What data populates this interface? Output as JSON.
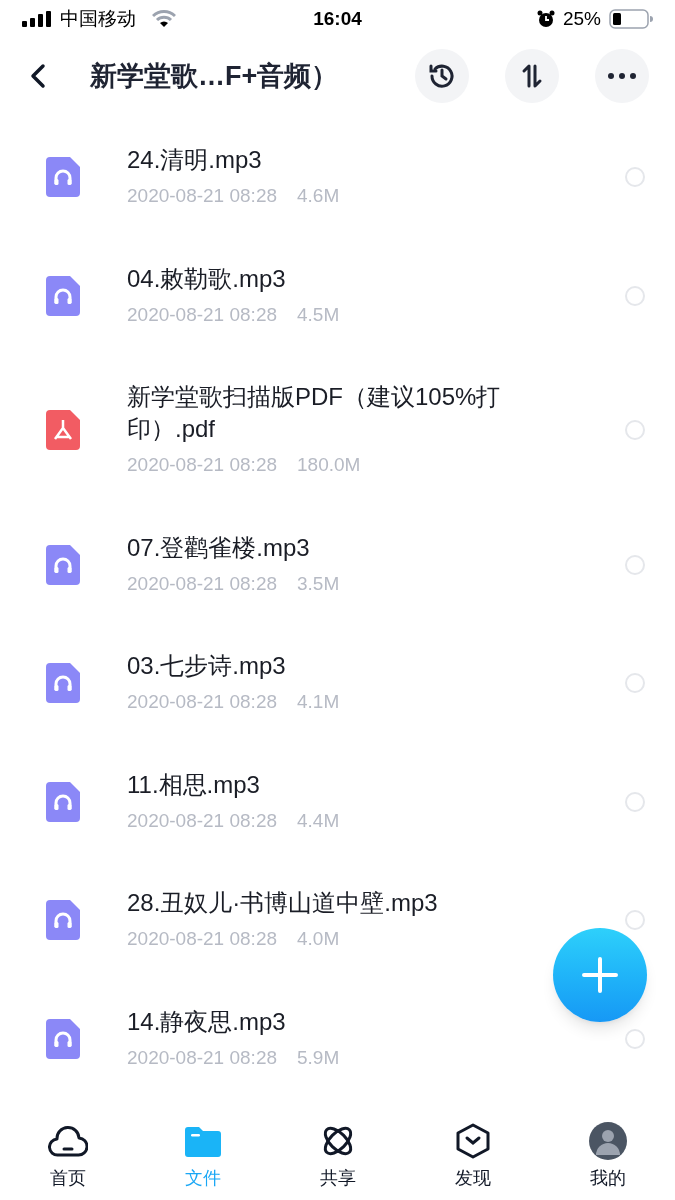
{
  "status_bar": {
    "carrier": "中国移动",
    "time": "16:04",
    "battery": "25%"
  },
  "nav": {
    "title": "新学堂歌…F+音频）"
  },
  "files": [
    {
      "kind": "audio",
      "name": "24.清明.mp3",
      "date": "2020-08-21 08:28",
      "size": "4.6M",
      "selected": false
    },
    {
      "kind": "audio",
      "name": "04.敕勒歌.mp3",
      "date": "2020-08-21 08:28",
      "size": "4.5M",
      "selected": false
    },
    {
      "kind": "pdf",
      "name": "新学堂歌扫描版PDF（建议105%打印）.pdf",
      "date": "2020-08-21 08:28",
      "size": "180.0M",
      "selected": false
    },
    {
      "kind": "audio",
      "name": "07.登鹳雀楼.mp3",
      "date": "2020-08-21 08:28",
      "size": "3.5M",
      "selected": false
    },
    {
      "kind": "audio",
      "name": "03.七步诗.mp3",
      "date": "2020-08-21 08:28",
      "size": "4.1M",
      "selected": false
    },
    {
      "kind": "audio",
      "name": "11.相思.mp3",
      "date": "2020-08-21 08:28",
      "size": "4.4M",
      "selected": false
    },
    {
      "kind": "audio",
      "name": "28.丑奴儿·书博山道中壁.mp3",
      "date": "2020-08-21 08:28",
      "size": "4.0M",
      "selected": false
    },
    {
      "kind": "audio",
      "name": "14.静夜思.mp3",
      "date": "2020-08-21 08:28",
      "size": "5.9M",
      "selected": false
    }
  ],
  "tab_bar": [
    {
      "kind": "cloud",
      "label": "首页",
      "selected": false
    },
    {
      "kind": "folder",
      "label": "文件",
      "selected": true
    },
    {
      "kind": "orbit",
      "label": "共享",
      "selected": false
    },
    {
      "kind": "box",
      "label": "发现",
      "selected": false
    },
    {
      "kind": "avatar",
      "label": "我的",
      "selected": false
    }
  ]
}
